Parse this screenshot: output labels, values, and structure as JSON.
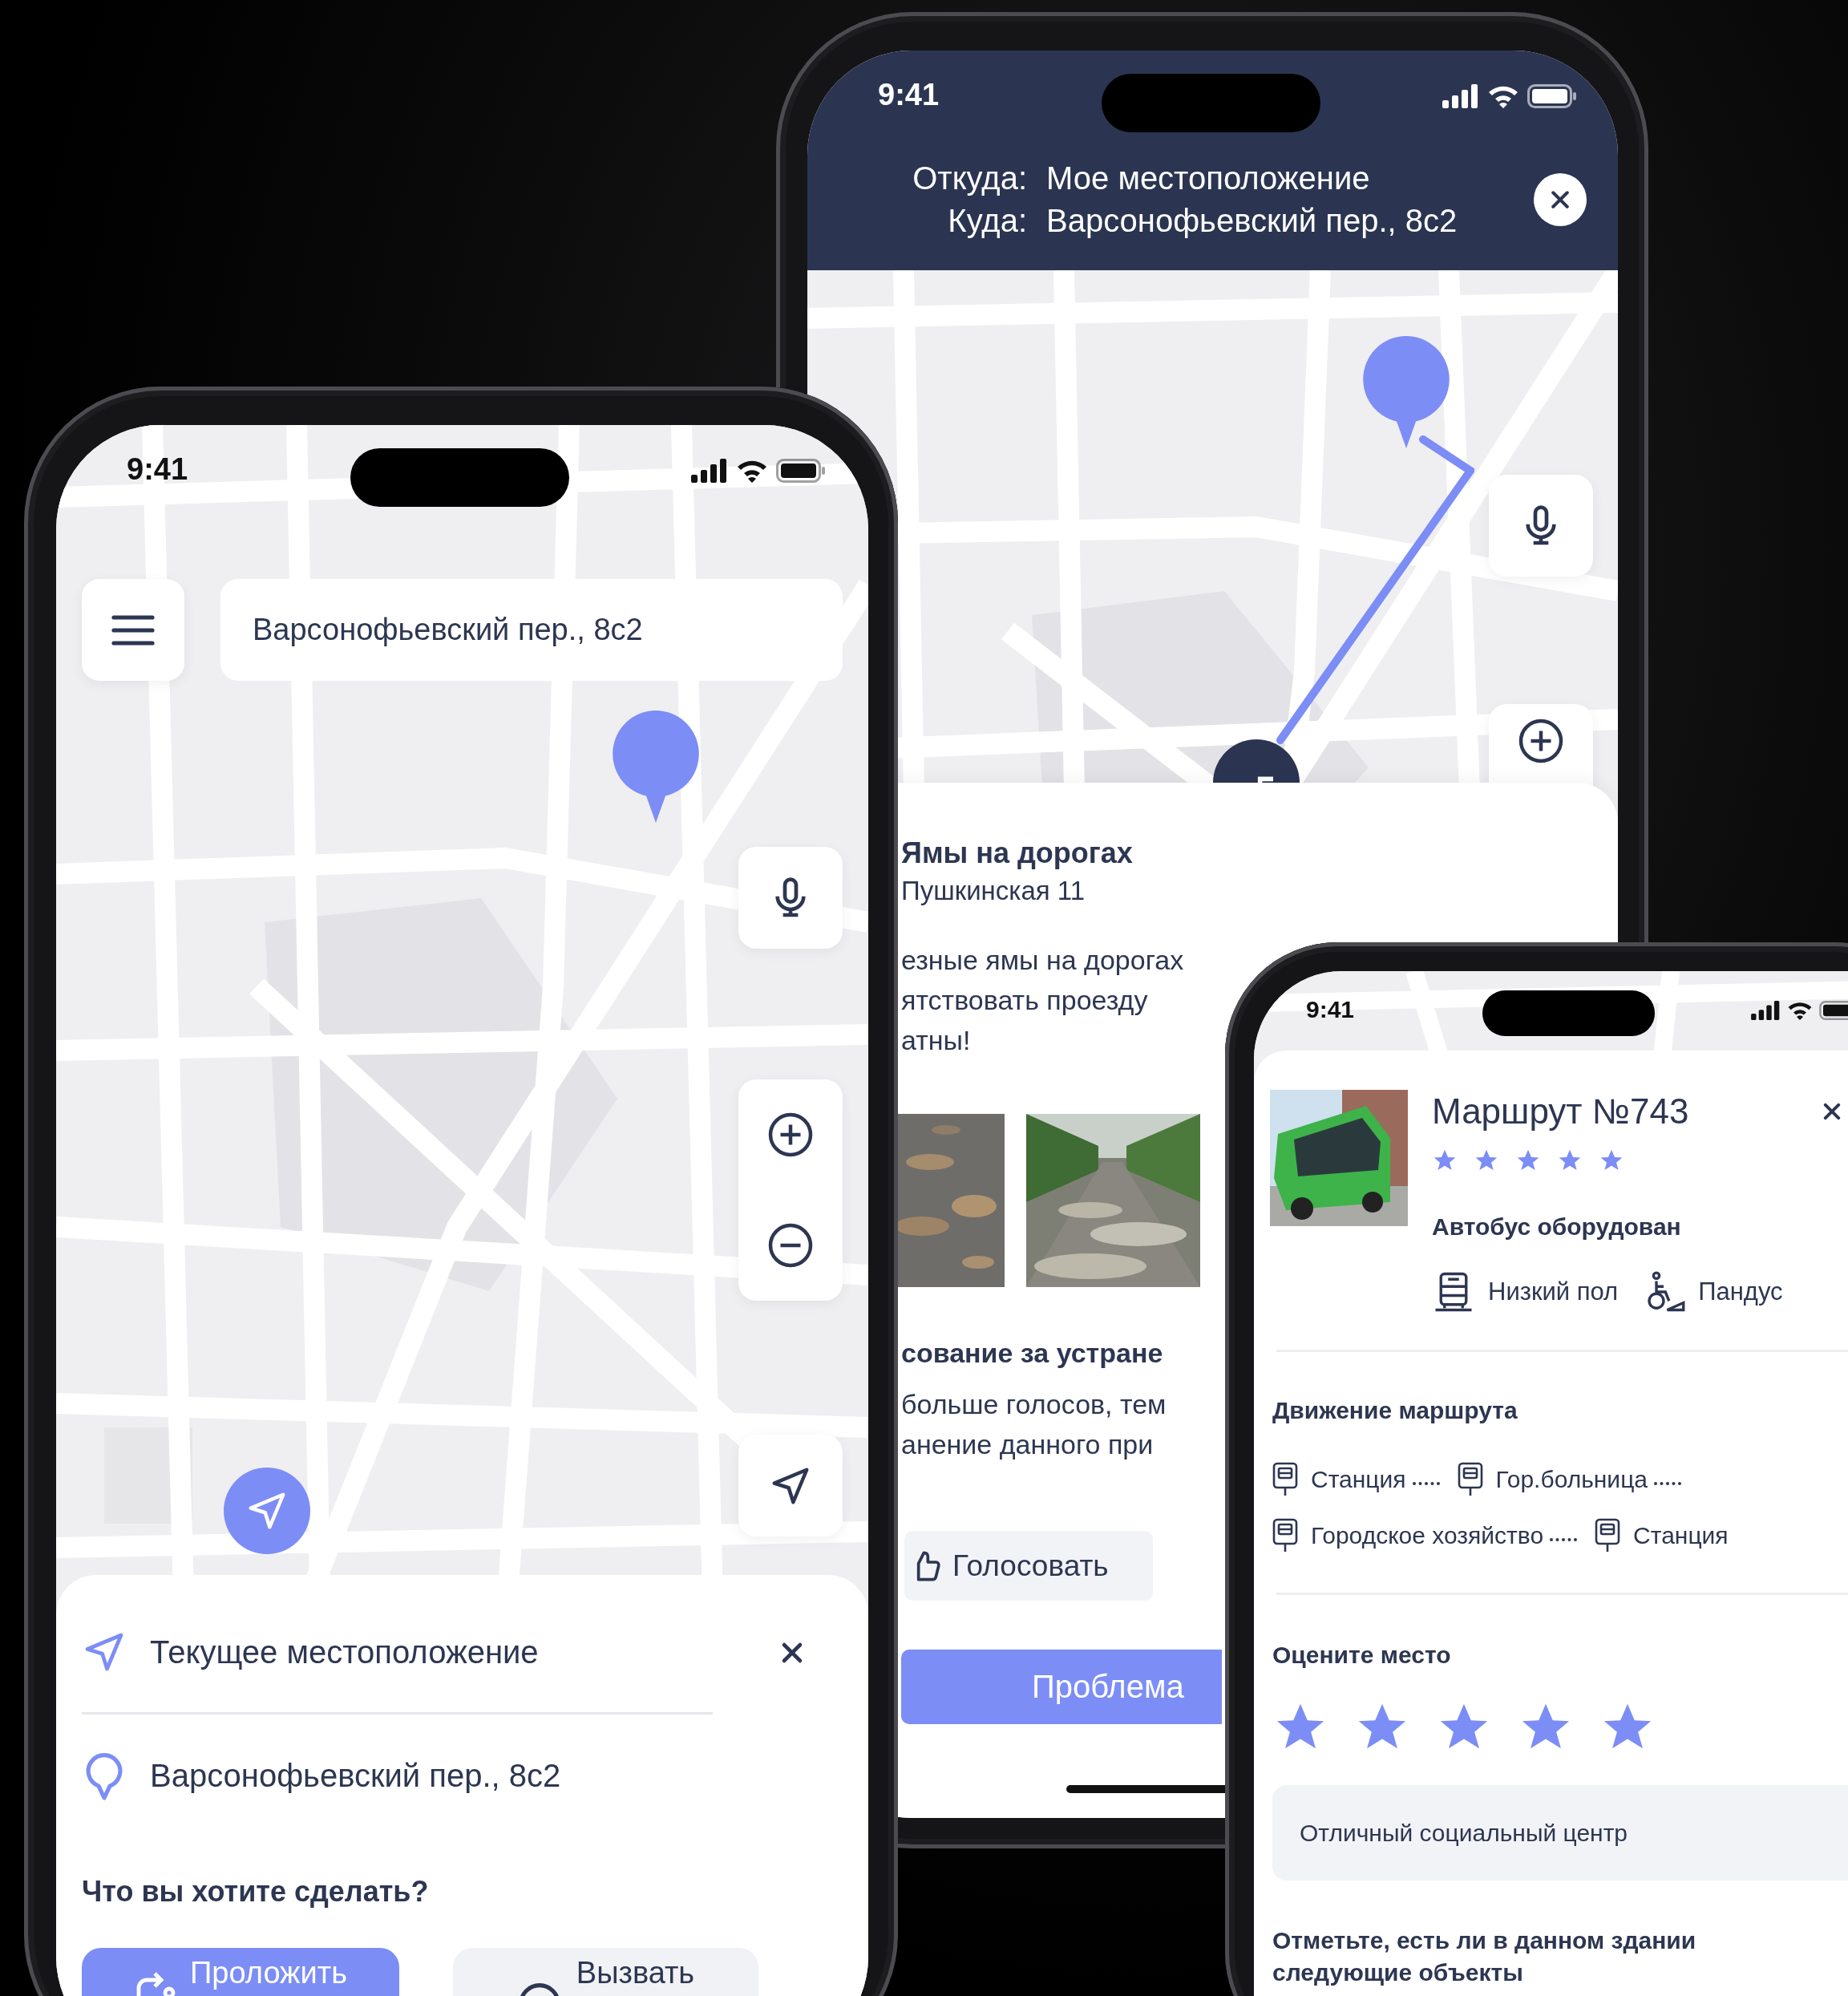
{
  "map_screen": {
    "status_bar": {
      "time": "9:41"
    },
    "search": {
      "value": "Варсонофьевский пер., 8с2"
    },
    "route_sheet": {
      "origin": "Текущее местоположение",
      "destination": "Варсонофьевский пер., 8с2",
      "prompt": "Что вы хотите сделать?",
      "actions": [
        {
          "kind": "route",
          "label": "Проложить"
        },
        {
          "kind": "call",
          "label": "Вызвать"
        }
      ]
    }
  },
  "route_screen": {
    "status_bar": {
      "time": "9:41"
    },
    "header": [
      {
        "label": "Откуда:",
        "value": "Мое местоположение"
      },
      {
        "label": "Куда:",
        "value": "Варсонофьевский пер., 8с2"
      }
    ],
    "issue": {
      "title": "Ямы на дорогах",
      "address": "Пушкинская 11",
      "description_lines": [
        "езные ямы на дорогах",
        "ятствовать проезду",
        "атны!"
      ]
    },
    "voting": {
      "title": "сование за устране",
      "lines": [
        "больше голосов, тем",
        "анение данного при"
      ],
      "vote_button": "Голосовать"
    },
    "report_button": "Проблема"
  },
  "bus_screen": {
    "status_bar": {
      "time": "9:41"
    },
    "route": {
      "title": "Маршрут №743",
      "stars": 5
    },
    "equipment": {
      "title": "Автобус оборудован",
      "features": [
        {
          "kind": "low_floor",
          "label": "Низкий пол"
        },
        {
          "kind": "ramp",
          "label": "Пандус"
        }
      ]
    },
    "movement": {
      "title": "Движение маршрута",
      "rows": [
        [
          {
            "name": "Станция"
          },
          {
            "name": "Гор.больница"
          }
        ],
        [
          {
            "name": "Городское хозяйство"
          },
          {
            "name": "Станция"
          }
        ]
      ]
    },
    "rating": {
      "title": "Оцените место",
      "stars": 5,
      "comment": "Отличный социальный центр"
    },
    "checklist_prompt": "Отметьте, есть ли в данном здании следующие объекты"
  }
}
